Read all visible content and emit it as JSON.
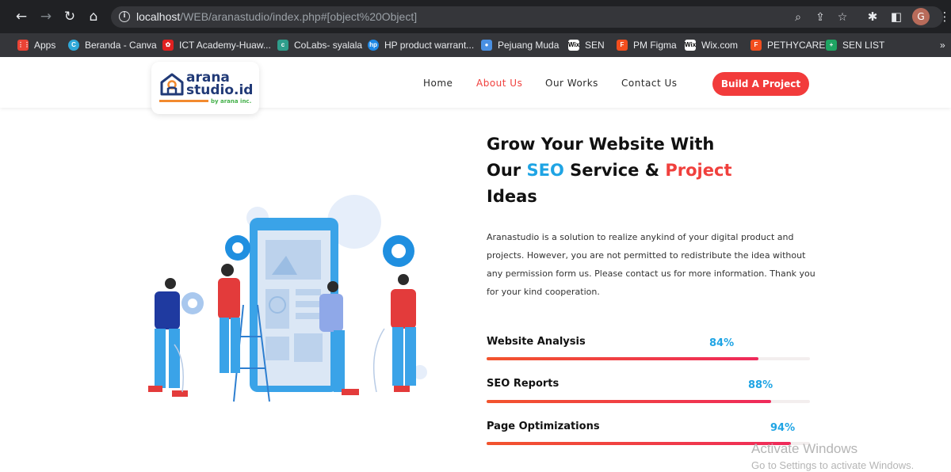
{
  "browser": {
    "url_host": "localhost",
    "url_path": "/WEB/aranastudio/index.php#[object%20Object]",
    "profile_initial": "G",
    "bookmarks": [
      {
        "label": "Apps",
        "icon": "apps-grid-icon",
        "color": "#ea4335"
      },
      {
        "label": "Beranda - Canva",
        "icon": "canva-icon",
        "color": "#2ea8d9"
      },
      {
        "label": "ICT Academy-Huaw...",
        "icon": "huawei-icon",
        "color": "#e02020"
      },
      {
        "label": "CoLabs- syalala",
        "icon": "colabs-icon",
        "color": "#2e9e8c"
      },
      {
        "label": "HP product warrant...",
        "icon": "hp-icon",
        "color": "#1e88e5"
      },
      {
        "label": "Pejuang Muda",
        "icon": "pejuang-muda-icon",
        "color": "#4a90e2"
      },
      {
        "label": "SEN",
        "icon": "wix-icon",
        "color": "#ffffff"
      },
      {
        "label": "PM Figma",
        "icon": "figma-icon",
        "color": "#f24e1e"
      },
      {
        "label": "Wix.com",
        "icon": "wix-icon",
        "color": "#ffffff"
      },
      {
        "label": "PETHYCARE",
        "icon": "figma-icon",
        "color": "#f24e1e"
      },
      {
        "label": "SEN LIST",
        "icon": "sheets-plus-icon",
        "color": "#1fa463"
      }
    ]
  },
  "site": {
    "logo": {
      "line1": "arana",
      "line2": "studio.id",
      "sub": "by arana inc."
    },
    "nav": [
      "Home",
      "About Us",
      "Our Works",
      "Contact Us"
    ],
    "active_nav": "About Us",
    "cta": "Build A Project",
    "colors": {
      "accent_red": "#f0403d",
      "accent_blue": "#1fa4e4",
      "navy": "#213a77"
    }
  },
  "hero": {
    "headline_part1": "Grow Your Website With",
    "headline_part2a": "Our ",
    "headline_seo": "SEO",
    "headline_part2b": " Service & ",
    "headline_project": "Project",
    "headline_part3": "Ideas",
    "description": "Aranastudio is a solution to realize anykind of your digital product and projects. However, you are not permitted to redistribute the idea without any permission form us. Please contact us for more information. Thank you for your kind cooperation."
  },
  "skills": [
    {
      "label": "Website Analysis",
      "percent_text": "84%",
      "value": 0.84
    },
    {
      "label": "SEO Reports",
      "percent_text": "88%",
      "value": 0.88
    },
    {
      "label": "Page Optimizations",
      "percent_text": "94%",
      "value": 0.94
    }
  ],
  "watermark": {
    "title": "Activate Windows",
    "subtitle": "Go to Settings to activate Windows."
  }
}
